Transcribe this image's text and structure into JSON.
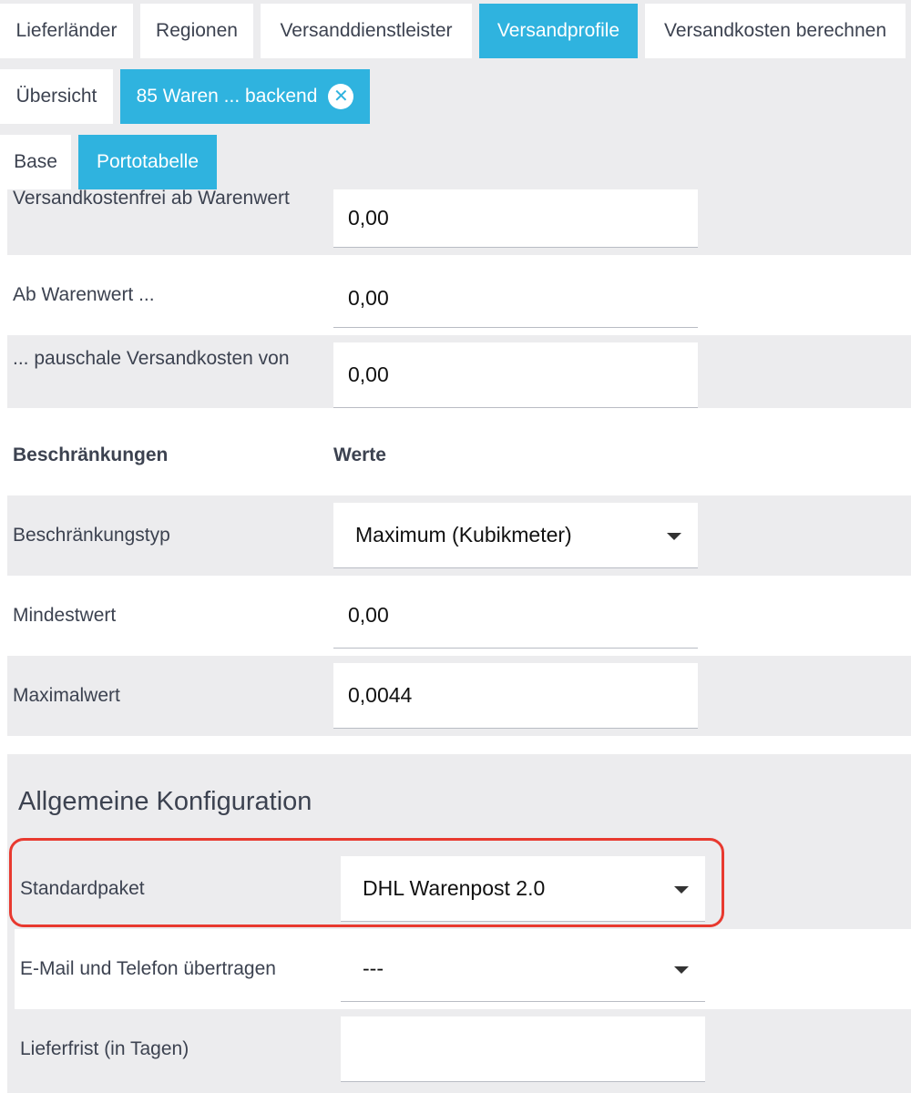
{
  "tabs_level1": [
    {
      "label": "Lieferländer"
    },
    {
      "label": "Regionen"
    },
    {
      "label": "Versanddienstleister"
    },
    {
      "label": "Versandprofile"
    },
    {
      "label": "Versandkosten berechnen"
    }
  ],
  "tabs_level2": {
    "overview": "Übersicht",
    "profile": "85 Waren ... backend",
    "close_glyph": "✕"
  },
  "tabs_level3": [
    {
      "label": "Base"
    },
    {
      "label": "Portotabelle"
    }
  ],
  "form": {
    "free_shipping_label": "Versandkostenfrei ab Warenwert",
    "free_shipping_value": "0,00",
    "from_value_label": "Ab Warenwert ...",
    "from_value_value": "0,00",
    "flat_cost_label": "... pauschale Versandkosten von",
    "flat_cost_value": "0,00",
    "restrictions_header": "Beschränkungen",
    "values_header": "Werte",
    "restriction_type_label": "Beschränkungstyp",
    "restriction_type_value": "Maximum (Kubikmeter)",
    "min_label": "Mindestwert",
    "min_value": "0,00",
    "max_label": "Maximalwert",
    "max_value": "0,0044"
  },
  "general_config": {
    "title": "Allgemeine Konfiguration",
    "standard_package_label": "Standardpaket",
    "standard_package_value": "DHL Warenpost 2.0",
    "email_phone_label": "E-Mail und Telefon übertragen",
    "email_phone_value": "---",
    "delivery_days_label": "Lieferfrist (in Tagen)",
    "delivery_days_value": ""
  },
  "colors": {
    "accent": "#2fb3df",
    "highlight": "#e8392f",
    "background": "#ececee"
  }
}
